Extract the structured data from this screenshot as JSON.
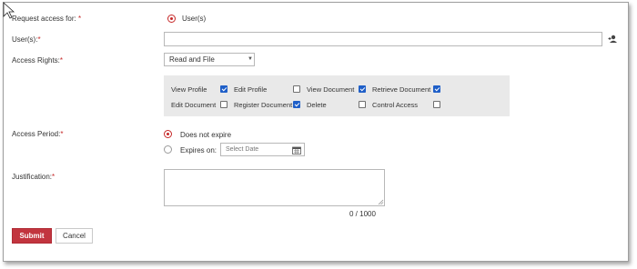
{
  "form": {
    "request_for": {
      "label": "Request access for:",
      "required_mark": "*",
      "option": "User(s)"
    },
    "users": {
      "label": "User(s):",
      "required_mark": "*",
      "value": "",
      "add_icon": "add-user-icon"
    },
    "access_rights": {
      "label": "Access Rights:",
      "required_mark": "*",
      "selected": "Read and File",
      "caret": "▼",
      "permissions": [
        {
          "label": "View Profile",
          "checked": true
        },
        {
          "label": "Edit Profile",
          "checked": false
        },
        {
          "label": "View Document",
          "checked": true
        },
        {
          "label": "Retrieve Document",
          "checked": true
        },
        {
          "label": "Edit Document",
          "checked": false
        },
        {
          "label": "Register Document",
          "checked": true
        },
        {
          "label": "Delete",
          "checked": false
        },
        {
          "label": "Control Access",
          "checked": false
        }
      ]
    },
    "access_period": {
      "label": "Access Period:",
      "required_mark": "*",
      "option_no_expire": "Does not expire",
      "option_expires": "Expires on:",
      "date_placeholder": "Select Date",
      "calendar_icon": "calendar-icon",
      "selected": "no_expire"
    },
    "justification": {
      "label": "Justification:",
      "required_mark": "*",
      "value": "",
      "counter": "0 / 1000"
    },
    "buttons": {
      "submit": "Submit",
      "cancel": "Cancel"
    }
  },
  "colors": {
    "accent": "#c2353f",
    "checkbox_checked": "#1f5fc8",
    "panel_bg": "#e9e9e9"
  }
}
